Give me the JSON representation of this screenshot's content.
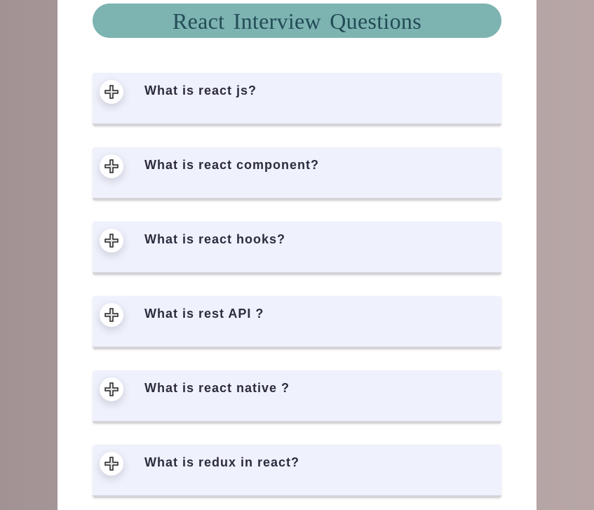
{
  "header": {
    "title": "React Interview Questions"
  },
  "faq": {
    "items": [
      {
        "question": "What is react js?",
        "icon": "plus-icon",
        "expanded": false
      },
      {
        "question": "What is react component?",
        "icon": "plus-icon",
        "expanded": false
      },
      {
        "question": "What is react hooks?",
        "icon": "plus-icon",
        "expanded": false
      },
      {
        "question": "What is rest API ?",
        "icon": "plus-icon",
        "expanded": false
      },
      {
        "question": "What is react native ?",
        "icon": "plus-icon",
        "expanded": false
      },
      {
        "question": "What is redux in react?",
        "icon": "plus-icon",
        "expanded": false
      }
    ]
  },
  "colors": {
    "backdrop": "#ad9fa1",
    "title_bar": "#7db3b1",
    "title_text": "#234c57",
    "card_bg": "#eff1fd",
    "question_text": "#2c2c3e"
  }
}
